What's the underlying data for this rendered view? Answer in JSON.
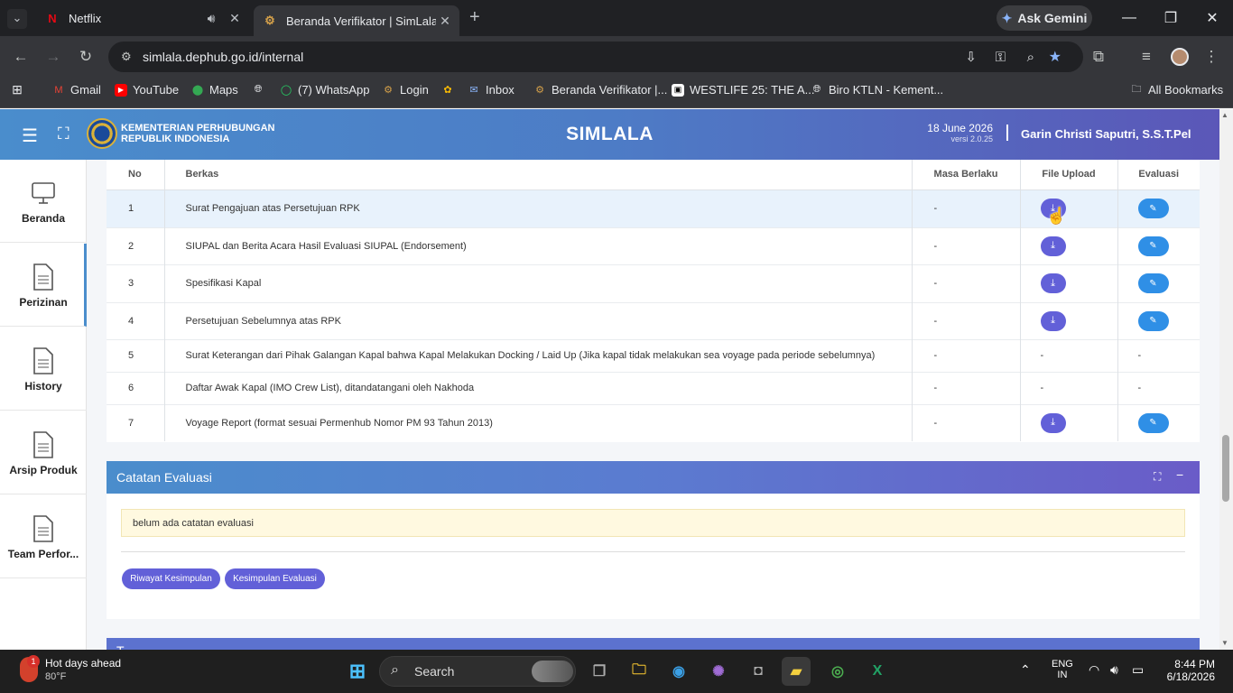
{
  "browser": {
    "tabs": [
      {
        "title": "Netflix",
        "icon": "netflix-icon",
        "audio": "speaker-icon"
      },
      {
        "title": "Beranda Verifikator | SimLala",
        "icon": "simlala-icon",
        "active": true
      }
    ],
    "ask_gemini": "Ask Gemini",
    "url": "simlala.dephub.go.id/internal",
    "bookmarks": [
      {
        "label": "Gmail"
      },
      {
        "label": "YouTube"
      },
      {
        "label": "Maps"
      },
      {
        "label": ""
      },
      {
        "label": "(7) WhatsApp"
      },
      {
        "label": "Login"
      },
      {
        "label": ""
      },
      {
        "label": "Inbox"
      },
      {
        "label": "Beranda Verifikator |..."
      },
      {
        "label": "WESTLIFE 25: THE A..."
      },
      {
        "label": "Biro KTLN - Kement..."
      }
    ],
    "all_bookmarks": "All Bookmarks"
  },
  "header": {
    "ministry_line1": "KEMENTERIAN PERHUBUNGAN",
    "ministry_line2": "REPUBLIK INDONESIA",
    "app_title": "SIMLALA",
    "date": "18 June 2026",
    "version": "versi 2.0.25",
    "user": "Garin Christi Saputri, S.S.T.Pel"
  },
  "sidebar": {
    "items": [
      {
        "label": "Beranda"
      },
      {
        "label": "Perizinan"
      },
      {
        "label": "History"
      },
      {
        "label": "Arsip Produk"
      },
      {
        "label": "Team Perfor..."
      }
    ]
  },
  "table": {
    "headers": {
      "no": "No",
      "berkas": "Berkas",
      "masa": "Masa Berlaku",
      "upload": "File Upload",
      "evaluasi": "Evaluasi"
    },
    "rows": [
      {
        "no": "1",
        "berkas": "Surat Pengajuan atas Persetujuan RPK",
        "masa": "-",
        "upload": "",
        "evaluasi": ""
      },
      {
        "no": "2",
        "berkas": "SIUPAL dan Berita Acara Hasil Evaluasi SIUPAL (Endorsement)",
        "masa": "-",
        "upload": "",
        "evaluasi": ""
      },
      {
        "no": "3",
        "berkas": "Spesifikasi Kapal",
        "masa": "-",
        "upload": "",
        "evaluasi": ""
      },
      {
        "no": "4",
        "berkas": "Persetujuan Sebelumnya atas RPK",
        "masa": "-",
        "upload": "",
        "evaluasi": ""
      },
      {
        "no": "5",
        "berkas": "Surat Keterangan dari Pihak Galangan Kapal bahwa Kapal Melakukan Docking / Laid Up (Jika kapal tidak melakukan sea voyage pada periode sebelumnya)",
        "masa": "-",
        "upload": "-",
        "evaluasi": "-"
      },
      {
        "no": "6",
        "berkas": "Daftar Awak Kapal (IMO Crew List), ditandatangani oleh Nakhoda",
        "masa": "-",
        "upload": "-",
        "evaluasi": "-"
      },
      {
        "no": "7",
        "berkas": "Voyage Report (format sesuai Permenhub Nomor PM 93 Tahun 2013)",
        "masa": "-",
        "upload": "",
        "evaluasi": ""
      }
    ]
  },
  "catatan": {
    "title": "Catatan Evaluasi",
    "note": "belum ada catatan evaluasi",
    "btn_riwayat": "Riwayat Kesimpulan",
    "btn_kesimpulan": "Kesimpulan Evaluasi",
    "next_card_title": "T"
  },
  "taskbar": {
    "weather_title": "Hot days ahead",
    "weather_temp": "80°F",
    "weather_badge": "1",
    "search": "Search",
    "lang1": "ENG",
    "lang2": "IN",
    "time": "8:44 PM",
    "date": "6/18/2026"
  },
  "colors": {
    "header_start": "#4a8dcc",
    "header_end": "#5b57b8",
    "download_btn": "#6260d8",
    "eval_btn": "#2f8fe6"
  }
}
